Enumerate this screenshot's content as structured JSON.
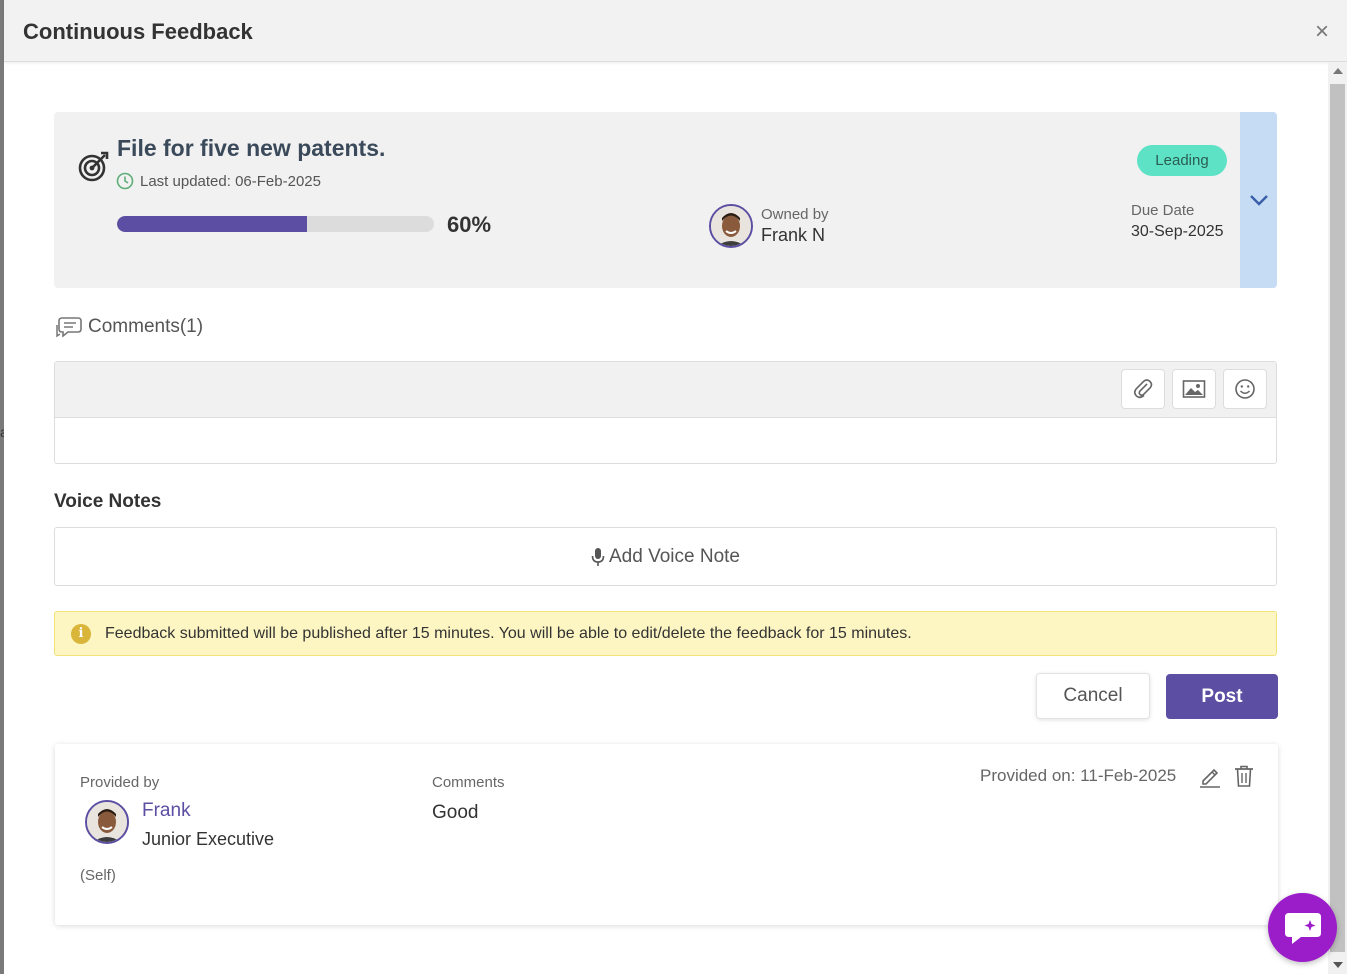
{
  "modal": {
    "title": "Continuous Feedback",
    "close": "×"
  },
  "goal": {
    "title": "File for five new patents.",
    "last_updated": "Last updated: 06-Feb-2025",
    "progress_percent": 60,
    "progress_label": "60%",
    "owned_by_label": "Owned by",
    "owner_name": "Frank N",
    "status_badge": "Leading",
    "due_date_label": "Due Date",
    "due_date": "30-Sep-2025"
  },
  "comments": {
    "header": "Comments(1)",
    "toolbar": [
      "attachment-icon",
      "image-icon",
      "emoji-icon"
    ]
  },
  "voice_notes": {
    "title": "Voice Notes",
    "add_label": "Add Voice Note"
  },
  "notice": {
    "icon": "i",
    "text": "Feedback submitted will be published after 15 minutes. You will be able to edit/delete the feedback for 15 minutes."
  },
  "actions": {
    "cancel": "Cancel",
    "post": "Post"
  },
  "feedback_entry": {
    "provided_by_label": "Provided by",
    "name": "Frank",
    "role": "Junior Executive",
    "self_tag": "(Self)",
    "comments_label": "Comments",
    "comment": "Good",
    "provided_on": "Provided on: 11-Feb-2025"
  },
  "colors": {
    "brand_purple": "#5b4ea3",
    "badge_teal": "#5ee2c6",
    "expand_blue": "#c6dcf5",
    "notice_yellow": "#fdf6c3",
    "chat_fab": "#9b1cc9"
  }
}
